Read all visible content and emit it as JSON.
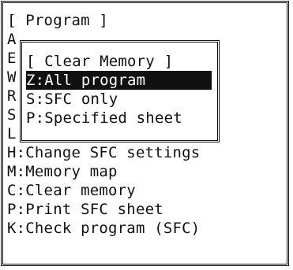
{
  "window": {
    "title": "[ Program ]"
  },
  "hidden_letters": [
    "A",
    "E",
    "W",
    "R",
    "S",
    "L"
  ],
  "menu": [
    {
      "text": "H:Change SFC settings"
    },
    {
      "text": "M:Memory map"
    },
    {
      "text": "C:Clear memory"
    },
    {
      "text": "P:Print SFC sheet"
    },
    {
      "text": "K:Check program (SFC)"
    }
  ],
  "popup": {
    "title": "[ Clear Memory ]",
    "options": [
      {
        "text": "Z:All program",
        "selected": true
      },
      {
        "text": "S:SFC only",
        "selected": false
      },
      {
        "text": "P:Specified sheet",
        "selected": false
      }
    ]
  },
  "colors": {
    "foreground": "#111111",
    "background": "#ffffff",
    "highlight_bg": "#111111",
    "highlight_fg": "#ffffff"
  }
}
